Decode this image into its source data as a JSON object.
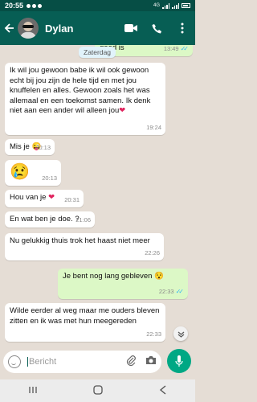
{
  "status_bar": {
    "time": "20:55",
    "signal_label": "4G"
  },
  "header": {
    "contact_name": "Dylan"
  },
  "chat": {
    "top_fragment": {
      "text": "goed is",
      "time": "13:49"
    },
    "date_chip": "Zaterdag",
    "messages": [
      {
        "dir": "in",
        "text": "Ik wil jou gewoon babe ik wil ook gewoon echt bij jou zijn de hele tijd en met jou knuffelen en alles. Gewoon zoals het was allemaal en een toekomst samen. Ik denk niet aan een ander wil alleen jou",
        "emoji": "❤",
        "time": "19:24"
      },
      {
        "dir": "in",
        "text": "Mis je",
        "emoji": "😜",
        "time": "20:13"
      },
      {
        "dir": "in",
        "text": "",
        "emoji": "😢",
        "time": "20:13"
      },
      {
        "dir": "in",
        "text": "Hou van je",
        "emoji": "❤",
        "time": "20:31"
      },
      {
        "dir": "in",
        "text": "En wat ben je doe. ?",
        "time": "21:06"
      },
      {
        "dir": "in",
        "text": "Nu gelukkig thuis trok het haast niet meer",
        "time": "22:26"
      },
      {
        "dir": "out",
        "text": "Je bent nog lang gebleven",
        "emoji": "😯",
        "time": "22:33"
      },
      {
        "dir": "in",
        "text": "Wilde eerder al weg maar me ouders bleven zitten en ik was met hun meegereden",
        "time": "22:33"
      }
    ]
  },
  "composer": {
    "placeholder": "Bericht"
  },
  "colors": {
    "header": "#075e54",
    "statusbar": "#064e45",
    "chat_bg": "#e5ddd5",
    "outgoing": "#dcf8c6",
    "accent": "#00a884",
    "read_ticks": "#34b7f1"
  },
  "icons": [
    "back-arrow-icon",
    "video-call-icon",
    "phone-icon",
    "more-vert-icon",
    "emoji-icon",
    "attach-icon",
    "camera-icon",
    "mic-icon",
    "scroll-down-icon"
  ]
}
